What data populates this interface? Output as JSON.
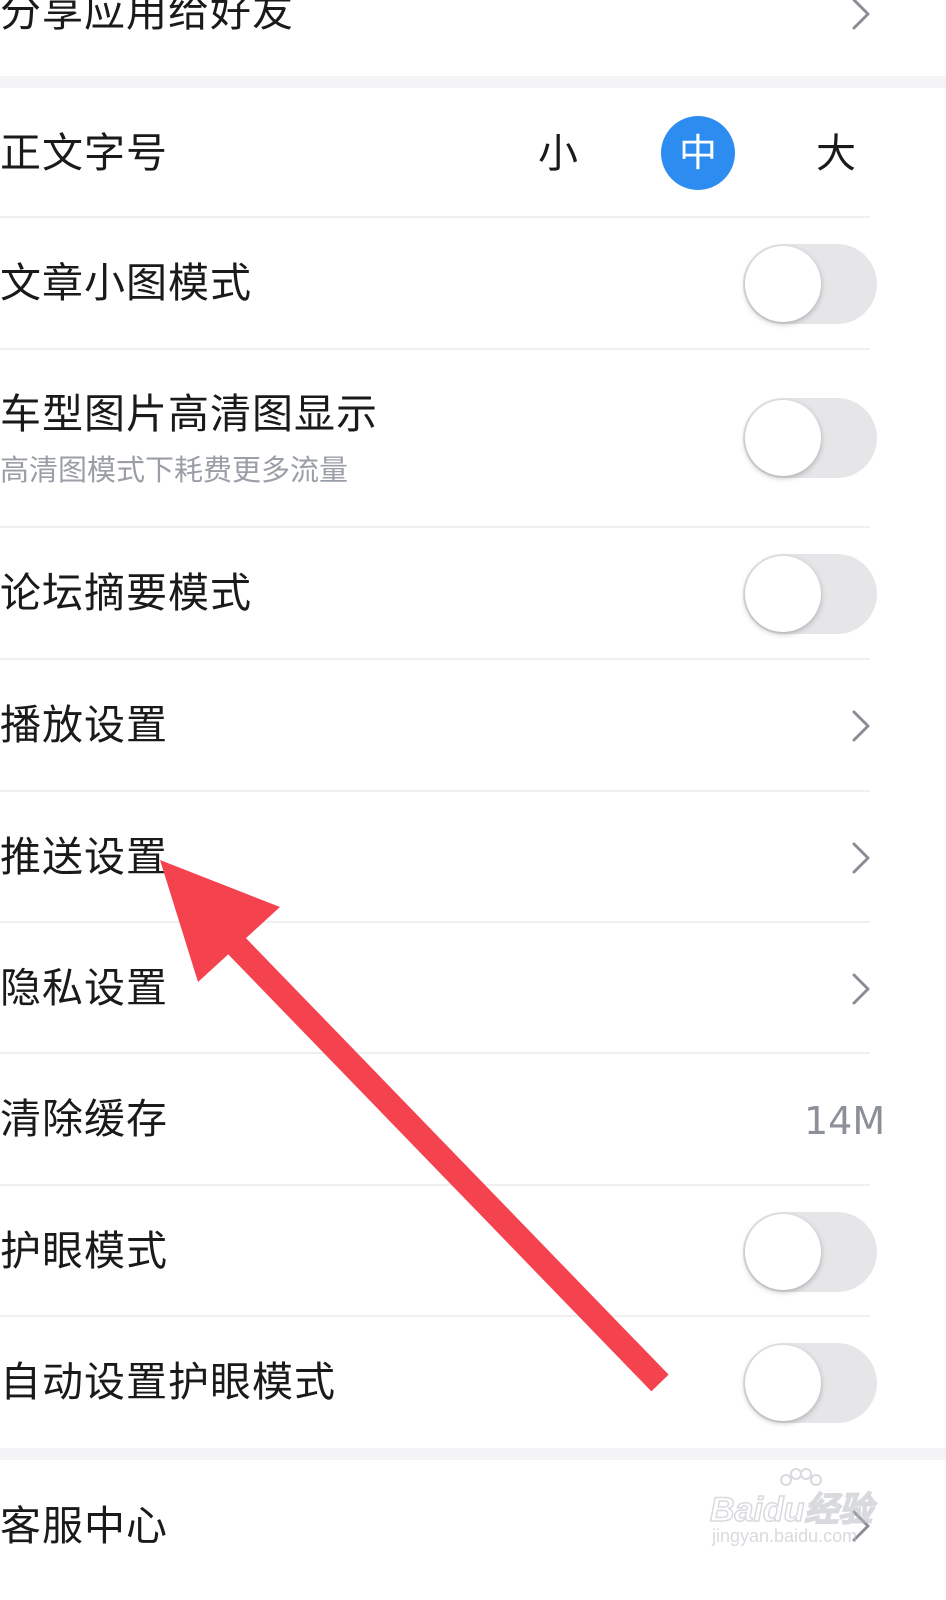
{
  "colors": {
    "accent": "#2d8cf0",
    "arrow": "#f5424f"
  },
  "settings": {
    "share_app": {
      "label": "分享应用给好友",
      "icon": "chevron-right-icon"
    },
    "font_size": {
      "label": "正文字号",
      "options": [
        "小",
        "中",
        "大"
      ],
      "selected": "中"
    },
    "article_small_image": {
      "label": "文章小图模式",
      "enabled": false
    },
    "hd_images": {
      "label": "车型图片高清图显示",
      "subtitle": "高清图模式下耗费更多流量",
      "enabled": false
    },
    "forum_summary": {
      "label": "论坛摘要模式",
      "enabled": false
    },
    "playback": {
      "label": "播放设置",
      "icon": "chevron-right-icon"
    },
    "push": {
      "label": "推送设置",
      "icon": "chevron-right-icon"
    },
    "privacy": {
      "label": "隐私设置",
      "icon": "chevron-right-icon"
    },
    "clear_cache": {
      "label": "清除缓存",
      "value": "14M"
    },
    "eye_care": {
      "label": "护眼模式",
      "enabled": false
    },
    "auto_eye_care": {
      "label": "自动设置护眼模式",
      "enabled": false
    },
    "customer_service": {
      "label": "客服中心",
      "icon": "chevron-right-icon"
    }
  },
  "watermark": {
    "brand": "Baidu经验",
    "url": "jingyan.baidu.com"
  }
}
